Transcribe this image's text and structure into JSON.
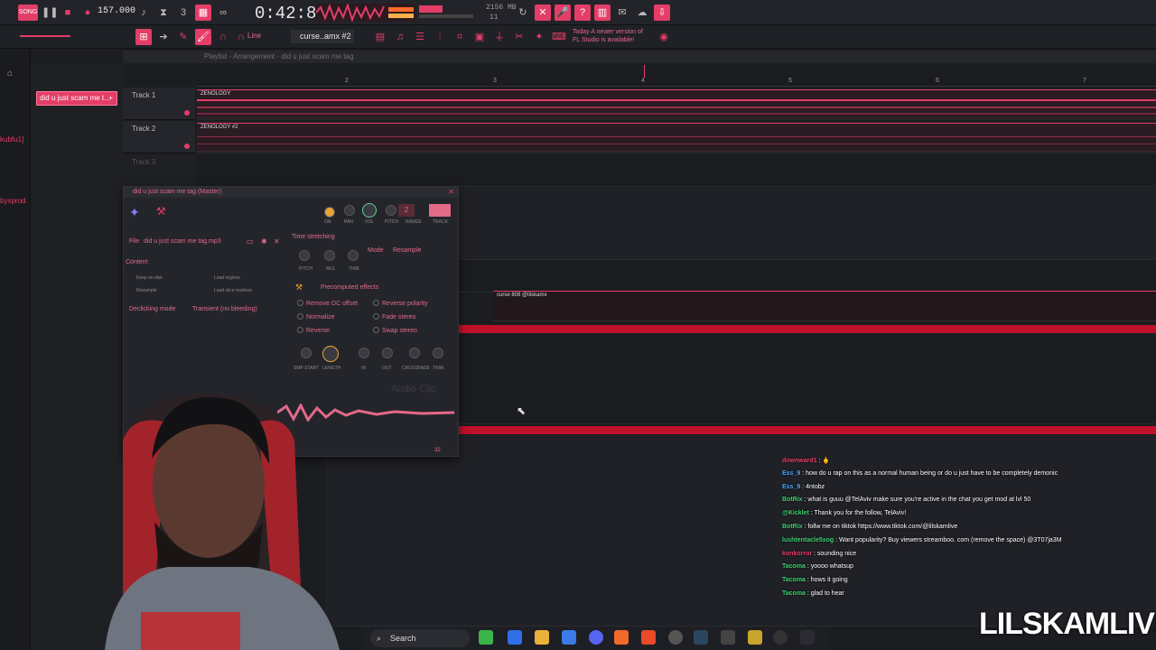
{
  "app": {
    "tempo": "157.000",
    "time": "0:42:86",
    "memory": "2156 MB",
    "cpu_count": "11",
    "pattern_name": "curse..amx #2",
    "snap_mode": "Line",
    "update_notice_1": "Today  A newer version of",
    "update_notice_2": "FL Studio is available!"
  },
  "playlist": {
    "header": "Playlist - Arrangement · did u just scam me tag",
    "ruler": [
      "2",
      "3",
      "4",
      "5",
      "6",
      "7"
    ],
    "tracks": [
      {
        "label": "Track 1",
        "clip": "ZENOLOGY"
      },
      {
        "label": "Track 2",
        "clip": "ZENOLOGY #2"
      },
      {
        "label": "Track 3",
        "clip": ""
      }
    ],
    "clip_curse": "curse 808 @lilskamx"
  },
  "left": {
    "pattern_button": "did u just scam me t...",
    "user1": "kubfu1]",
    "user2": "byxprod"
  },
  "channel": {
    "title": "did u just scam me tag (Master)",
    "file_label": "File",
    "file_name": "did u just scam me tag.mp3",
    "content_label": "Content",
    "keep_on_disk": "Keep on disk",
    "resample": "Resample",
    "load_regions": "Load regions",
    "load_slice_markers": "Load slice markers",
    "declicking_label": "Declicking mode",
    "declicking_value": "Transient (no bleeding)",
    "time_stretching": "Time stretching",
    "mode_label": "Mode",
    "mode_value": "Resample",
    "precomputed": "Precomputed effects",
    "effects": [
      "Remove DC offset",
      "Normalize",
      "Reverse",
      "Reverse polarity",
      "Fade stereo",
      "Swap stereo"
    ],
    "top_knob_labels": [
      "ON",
      "PAN",
      "VOL",
      "PITCH",
      "RANGE",
      "TRACK"
    ],
    "ts_knob_labels": [
      "PITCH",
      "MUL",
      "TIME"
    ],
    "bottom_knob_labels": [
      "SMP START",
      "LENGTH",
      "IN",
      "OUT",
      "CROSSFADE",
      "TRIM"
    ],
    "range_value": "2",
    "watermark": "Audio Clip",
    "page": "32"
  },
  "chat": [
    {
      "user": "downward1",
      "text": ": 🖕",
      "color": "#e33d68"
    },
    {
      "user": "Ess_9",
      "text": ": how do u rap on this as a normal human being or do u just have to be completely demonic",
      "color": "#4aa8ff"
    },
    {
      "user": "Ess_9",
      "text": ": 4ntobz",
      "color": "#4aa8ff"
    },
    {
      "user": "BotRix",
      "text": ": what is guuu @TelAviv make sure you're active in the chat you get mod at lvl 50",
      "color": "#3bd16f"
    },
    {
      "user": "@Kicklet",
      "text": ": Thank you for the follow, TelAviv!",
      "color": "#3bd16f"
    },
    {
      "user": "BotRix",
      "text": ": follw me on tiktok https://www.tiktok.com/@lilskamlive",
      "color": "#3bd16f"
    },
    {
      "user": "lushtentacle5xog",
      "text": ": Want popularity? Buy viewers streamboo. com (remove the space) @3T07ja3M",
      "color": "#3bd16f"
    },
    {
      "user": "konkorror",
      "text": ": sounding nice",
      "color": "#e33d68"
    },
    {
      "user": "Tacoma",
      "text": ": yoooo whatsup",
      "color": "#3bd16f"
    },
    {
      "user": "Tacoma",
      "text": ": hows it going",
      "color": "#3bd16f"
    },
    {
      "user": "Tacoma",
      "text": ": glad to hear",
      "color": "#3bd16f"
    }
  ],
  "taskbar": {
    "search": "Search"
  },
  "brand": "LILSKAMLIVE",
  "colors": {
    "accent": "#e33d68",
    "clip_red": "#c0112b",
    "bg": "#1c1d20"
  }
}
